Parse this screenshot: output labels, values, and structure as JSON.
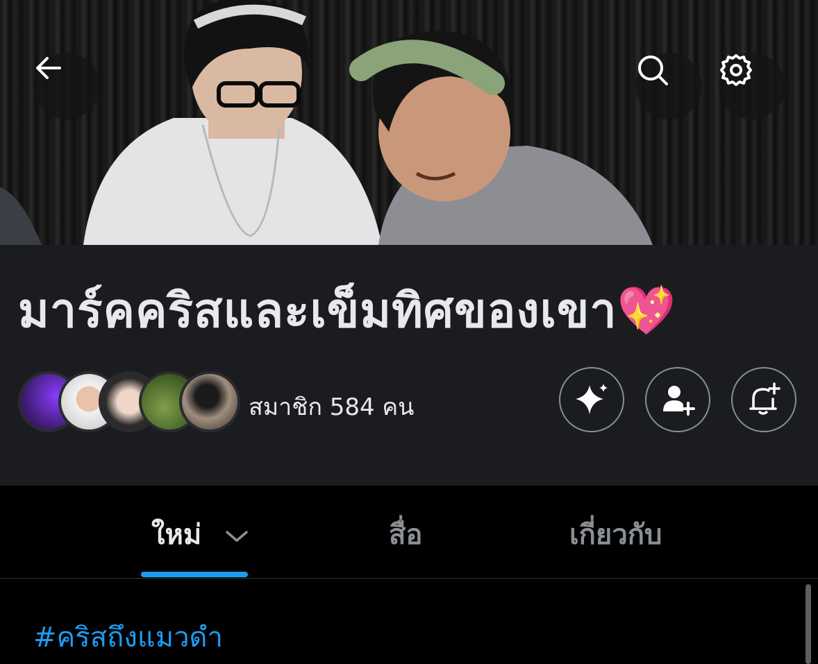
{
  "banner": {
    "image_name": "cover-photo",
    "back_icon": "arrow-left-icon",
    "search_icon": "search-icon",
    "settings_icon": "gear-icon"
  },
  "community": {
    "title": "มาร์คคริสและเข็มทิศของเขา💖",
    "members_text": "สมาชิก 584 คน",
    "actions": [
      "sparkle-icon",
      "add-user-icon",
      "bell-plus-icon"
    ]
  },
  "tabs": [
    {
      "label": "ใหม่",
      "active": true,
      "chevron": "˅"
    },
    {
      "label": "สื่อ",
      "active": false
    },
    {
      "label": "เกี่ยวกับ",
      "active": false
    }
  ],
  "feed": {
    "hashtag": "#คริสถึงแมวดำ"
  },
  "colors": {
    "accent": "#1d9bf0",
    "panel_bg": "#1b1c20",
    "text": "#e7e9ea",
    "muted": "#8b8f96"
  }
}
